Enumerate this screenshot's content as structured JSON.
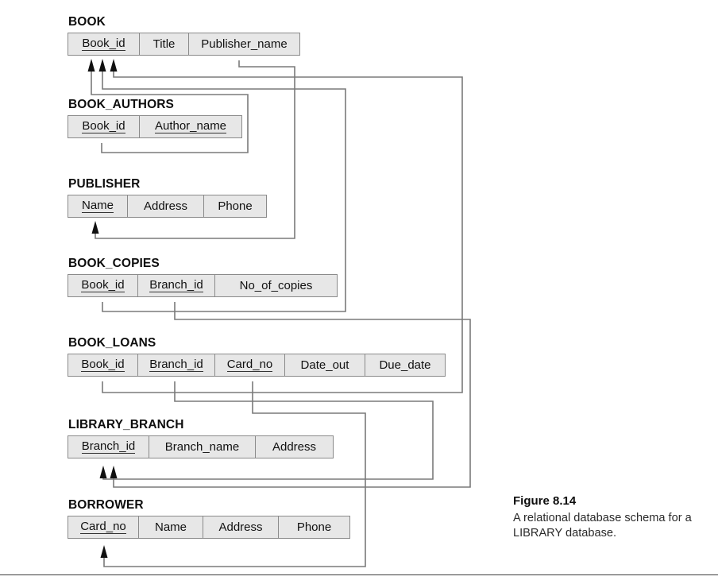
{
  "figure": {
    "number": "Figure 8.14",
    "description": "A relational database schema for a LIBRARY database."
  },
  "diagram": {
    "type": "relational-schema",
    "notation": "Underlined attributes are primary keys; arrows point from foreign key attributes to the referenced primary key attributes.",
    "colors": {
      "attribute_fill": "#e7e7e7",
      "border": "#8a8a8a",
      "connector": "#7a7a7a",
      "arrowhead": "#111111",
      "text": "#111111"
    },
    "relations": [
      {
        "name": "BOOK",
        "attributes": [
          {
            "label": "Book_id",
            "primary_key": true
          },
          {
            "label": "Title",
            "primary_key": false
          },
          {
            "label": "Publisher_name",
            "primary_key": false
          }
        ]
      },
      {
        "name": "BOOK_AUTHORS",
        "attributes": [
          {
            "label": "Book_id",
            "primary_key": true
          },
          {
            "label": "Author_name",
            "primary_key": true
          }
        ]
      },
      {
        "name": "PUBLISHER",
        "attributes": [
          {
            "label": "Name",
            "primary_key": true
          },
          {
            "label": "Address",
            "primary_key": false
          },
          {
            "label": "Phone",
            "primary_key": false
          }
        ]
      },
      {
        "name": "BOOK_COPIES",
        "attributes": [
          {
            "label": "Book_id",
            "primary_key": true
          },
          {
            "label": "Branch_id",
            "primary_key": true
          },
          {
            "label": "No_of_copies",
            "primary_key": false
          }
        ]
      },
      {
        "name": "BOOK_LOANS",
        "attributes": [
          {
            "label": "Book_id",
            "primary_key": true
          },
          {
            "label": "Branch_id",
            "primary_key": true
          },
          {
            "label": "Card_no",
            "primary_key": true
          },
          {
            "label": "Date_out",
            "primary_key": false
          },
          {
            "label": "Due_date",
            "primary_key": false
          }
        ]
      },
      {
        "name": "LIBRARY_BRANCH",
        "attributes": [
          {
            "label": "Branch_id",
            "primary_key": true
          },
          {
            "label": "Branch_name",
            "primary_key": false
          },
          {
            "label": "Address",
            "primary_key": false
          }
        ]
      },
      {
        "name": "BORROWER",
        "attributes": [
          {
            "label": "Card_no",
            "primary_key": true
          },
          {
            "label": "Name",
            "primary_key": false
          },
          {
            "label": "Address",
            "primary_key": false
          },
          {
            "label": "Phone",
            "primary_key": false
          }
        ]
      }
    ],
    "foreign_keys": [
      {
        "from_relation": "BOOK",
        "from_attribute": "Publisher_name",
        "to_relation": "PUBLISHER",
        "to_attribute": "Name"
      },
      {
        "from_relation": "BOOK_AUTHORS",
        "from_attribute": "Book_id",
        "to_relation": "BOOK",
        "to_attribute": "Book_id"
      },
      {
        "from_relation": "BOOK_COPIES",
        "from_attribute": "Book_id",
        "to_relation": "BOOK",
        "to_attribute": "Book_id"
      },
      {
        "from_relation": "BOOK_COPIES",
        "from_attribute": "Branch_id",
        "to_relation": "LIBRARY_BRANCH",
        "to_attribute": "Branch_id"
      },
      {
        "from_relation": "BOOK_LOANS",
        "from_attribute": "Book_id",
        "to_relation": "BOOK",
        "to_attribute": "Book_id"
      },
      {
        "from_relation": "BOOK_LOANS",
        "from_attribute": "Branch_id",
        "to_relation": "LIBRARY_BRANCH",
        "to_attribute": "Branch_id"
      },
      {
        "from_relation": "BOOK_LOANS",
        "from_attribute": "Card_no",
        "to_relation": "BORROWER",
        "to_attribute": "Card_no"
      }
    ]
  }
}
